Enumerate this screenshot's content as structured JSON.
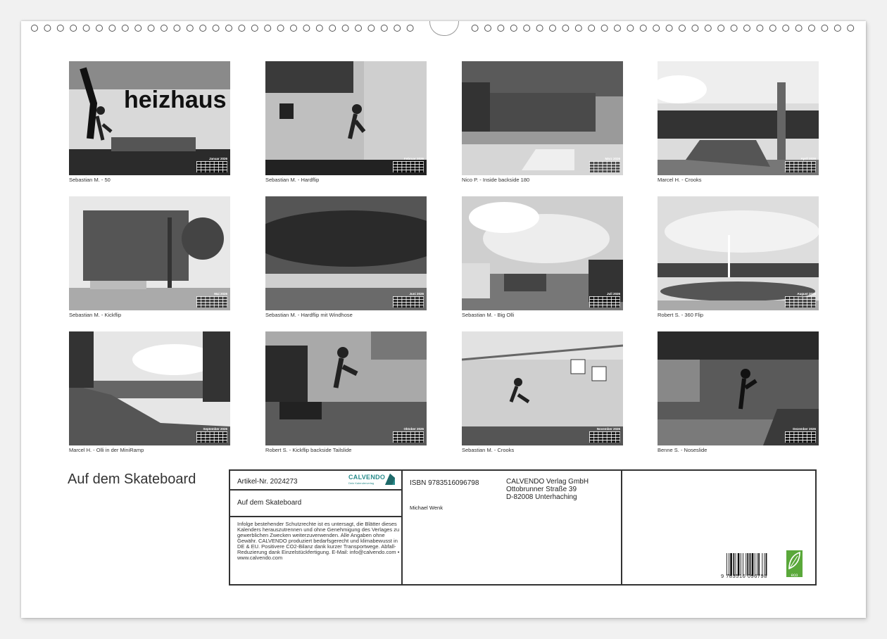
{
  "calendar": {
    "title": "Auf dem Skateboard",
    "photos": [
      {
        "caption": "Sebastian M. - 50",
        "month": "Januar 2026",
        "logo_text": "heizhaus"
      },
      {
        "caption": "Sebastian M. - Hardflip",
        "month": "Februar 2026"
      },
      {
        "caption": "Nico P. - Inside backside 180",
        "month": "März 2026"
      },
      {
        "caption": "Marcel H. - Crooks",
        "month": "April 2026"
      },
      {
        "caption": "Sebastian M. - Kickflip",
        "month": "Mai 2026"
      },
      {
        "caption": "Sebastian M. - Hardflip mit Windhose",
        "month": "Juni 2026"
      },
      {
        "caption": "Sebastian M. - Big Olli",
        "month": "Juli 2026"
      },
      {
        "caption": "Robert S. - 360 Flip",
        "month": "August 2026"
      },
      {
        "caption": "Marcel H. - Olli in der MiniRamp",
        "month": "September 2026"
      },
      {
        "caption": "Robert S. - Kickflip backside Tailslide",
        "month": "Oktober 2026"
      },
      {
        "caption": "Sebastian M. - Crooks",
        "month": "November 2026"
      },
      {
        "caption": "Benne S. - Noseslide",
        "month": "Dezember 2026"
      }
    ]
  },
  "info": {
    "article_no": "Artikel-Nr. 2024273",
    "publisher_logo": "CALVENDO",
    "publisher_tagline": "Dein Kalenderverlag",
    "product_title": "Auf dem Skateboard",
    "legal_text": "Infolge bestehender Schutzrechte ist es untersagt, die Blätter dieses Kalenders herauszutrennen und ohne Genehmigung des Verlages zu gewerblichen Zwecken weiterzuverwenden. Alle Angaben ohne Gewähr. CALVENDO produziert bedarfsgerecht und klimabewusst in DE & EU. Positivere CO2-Bilanz dank kurzer Transportwege. Abfall-Reduzierung dank Einzelstückfertigung. E-Mail: info@calvendo.com • www.calvendo.com",
    "isbn": "ISBN 9783516096798",
    "author": "Michael Wenk",
    "publisher_name": "CALVENDO Verlag GmbH",
    "publisher_street": "Ottobrunner Straße 39",
    "publisher_city": "D-82008 Unterhaching",
    "barcode_number": "9 783516 096798",
    "eco_label": "eco"
  },
  "colors": {
    "brand_teal": "#2a8c8c",
    "eco_green": "#5aa83a"
  }
}
